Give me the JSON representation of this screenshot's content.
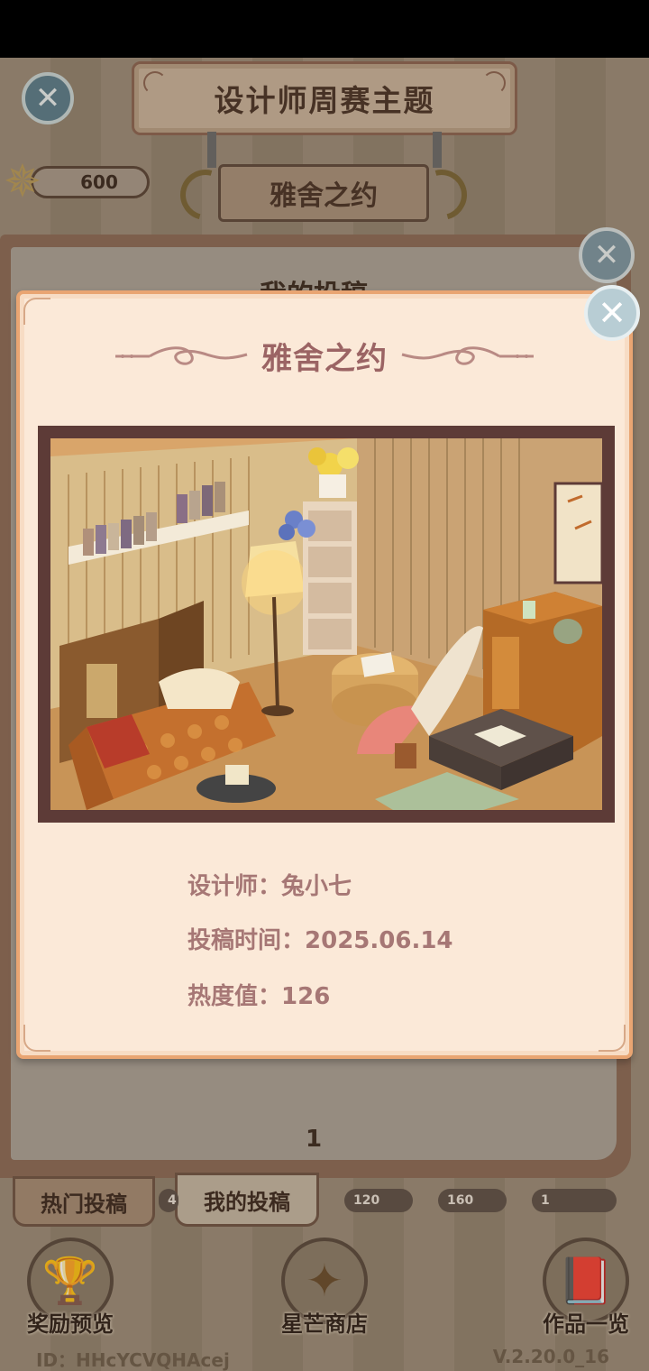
{
  "header": {
    "title": "设计师周赛主题",
    "subtitle": "雅舍之约",
    "star_count": "600"
  },
  "list_panel": {
    "title": "我的投稿",
    "page": "1"
  },
  "tabs": [
    {
      "label": "热门投稿"
    },
    {
      "label": "我的投稿"
    }
  ],
  "chips": [
    "4",
    "120",
    "160",
    "1"
  ],
  "bottom_nav": [
    {
      "label": "奖励预览",
      "icon": "trophy-icon"
    },
    {
      "label": "星芒商店",
      "icon": "star-shop-icon"
    },
    {
      "label": "作品一览",
      "icon": "book-icon"
    }
  ],
  "footer": {
    "player_id": "ID：HHcYCVQHAcej",
    "version": "V.2.20.0_16"
  },
  "modal": {
    "title": "雅舍之约",
    "designer_label": "设计师：",
    "designer_name": "兔小七",
    "submit_label": "投稿时间：",
    "submit_date": "2025.06.14",
    "heat_label": "热度值：",
    "heat_value": "126"
  },
  "colors": {
    "modal_bg": "#fbe9d8",
    "modal_border": "#e9a572",
    "title_text": "#9b6464",
    "info_text": "#a67775",
    "frame": "#5d3b37"
  }
}
